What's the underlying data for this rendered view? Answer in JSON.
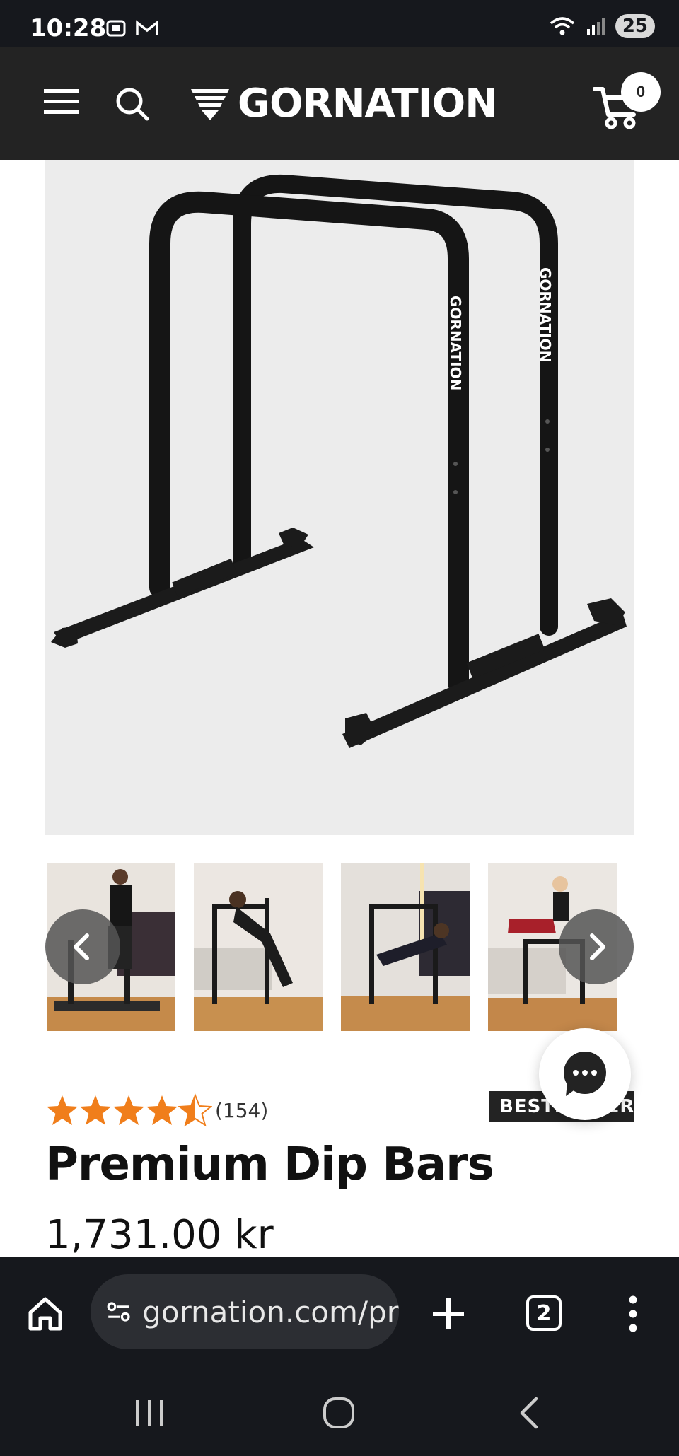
{
  "status_bar": {
    "time": "10:28",
    "battery": "25"
  },
  "header": {
    "logo_text": "GORNATION",
    "cart_count": "0"
  },
  "product": {
    "review_count": "(154)",
    "badge": "BESTSELLER",
    "title": "Premium Dip Bars",
    "price": "1,731.00 kr",
    "rating": 4.5,
    "rating_max": 5
  },
  "browser": {
    "url": "gornation.com/pr",
    "tab_count": "2"
  },
  "colors": {
    "header_bg": "#232323",
    "star": "#f07e1b",
    "system_bar": "#16181d"
  },
  "icons": [
    "menu-icon",
    "search-icon",
    "cart-icon",
    "chevron-left-icon",
    "chevron-right-icon",
    "chat-icon",
    "star-icon",
    "home-icon",
    "site-settings-icon",
    "plus-icon",
    "more-icon"
  ]
}
